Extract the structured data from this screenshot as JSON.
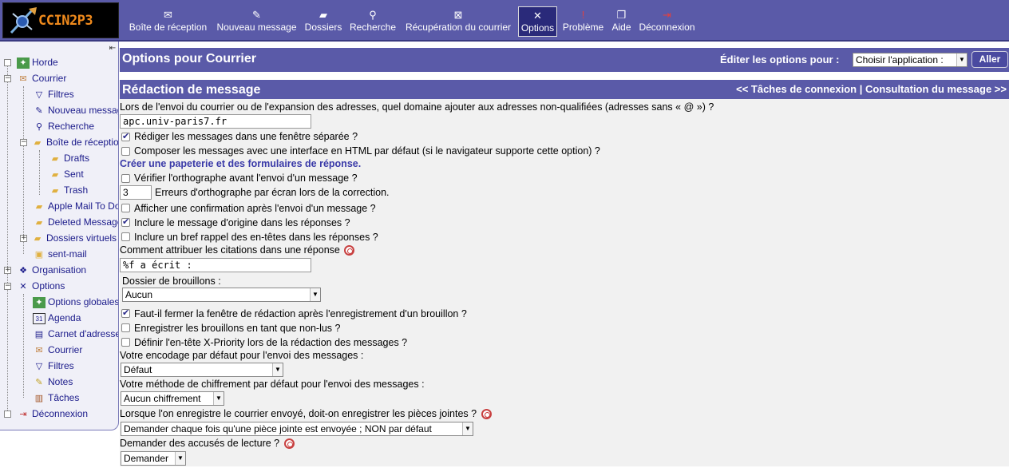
{
  "logo": {
    "text": "CCIN2P3"
  },
  "nav": {
    "items": [
      {
        "label": "Boîte de réception",
        "icon": "mail-icon"
      },
      {
        "label": "Nouveau message",
        "icon": "compose-icon"
      },
      {
        "label": "Dossiers",
        "icon": "folder-icon"
      },
      {
        "label": "Recherche",
        "icon": "search-icon"
      },
      {
        "label": "Récupération du courrier",
        "icon": "fetch-mail-icon"
      },
      {
        "label": "Options",
        "icon": "tools-icon",
        "active": true
      },
      {
        "label": "Problème",
        "icon": "problem-icon"
      },
      {
        "label": "Aide",
        "icon": "help-book-icon"
      },
      {
        "label": "Déconnexion",
        "icon": "logout-icon"
      }
    ]
  },
  "sidebar": {
    "items": [
      {
        "label": "Horde",
        "icon": "horde-icon"
      },
      {
        "label": "Courrier",
        "icon": "mail-icon"
      },
      {
        "label": "Filtres",
        "icon": "filter-icon"
      },
      {
        "label": "Nouveau message",
        "icon": "compose-icon"
      },
      {
        "label": "Recherche",
        "icon": "search-icon"
      },
      {
        "label": "Boîte de réception",
        "icon": "folder-icon"
      },
      {
        "label": "Drafts",
        "icon": "folder-icon"
      },
      {
        "label": "Sent",
        "icon": "folder-icon"
      },
      {
        "label": "Trash",
        "icon": "folder-icon"
      },
      {
        "label": "Apple Mail To Do",
        "icon": "folder-icon"
      },
      {
        "label": "Deleted Messages",
        "icon": "folder-icon"
      },
      {
        "label": "Dossiers virtuels",
        "icon": "folder-icon"
      },
      {
        "label": "sent-mail",
        "icon": "sent-mail-icon"
      },
      {
        "label": "Organisation",
        "icon": "organisation-icon"
      },
      {
        "label": "Options",
        "icon": "tools-icon"
      },
      {
        "label": "Options globales",
        "icon": "horde-icon"
      },
      {
        "label": "Agenda",
        "icon": "calendar-icon"
      },
      {
        "label": "Carnet d'adresses",
        "icon": "addressbook-icon"
      },
      {
        "label": "Courrier",
        "icon": "mail-icon"
      },
      {
        "label": "Filtres",
        "icon": "filter-icon"
      },
      {
        "label": "Notes",
        "icon": "notes-icon"
      },
      {
        "label": "Tâches",
        "icon": "tasks-icon"
      },
      {
        "label": "Déconnexion",
        "icon": "logout-icon"
      }
    ]
  },
  "header": {
    "title": "Options pour Courrier",
    "edit_label": "Éditer les options pour :",
    "app_select_value": "Choisir l'application :",
    "go_label": "Aller"
  },
  "section": {
    "title": "Rédaction de message",
    "prev_link": "<< Tâches de connexion",
    "separator": "|",
    "next_link": "Consultation du message >>"
  },
  "form": {
    "domain_question": "Lors de l'envoi du courrier ou de l'expansion des adresses, quel domaine ajouter aux adresses non-qualifiées (adresses sans « @ ») ?",
    "domain_value": "apc.univ-paris7.fr",
    "separate_window": {
      "label": "Rédiger les messages dans une fenêtre séparée ?",
      "checked": true
    },
    "html_compose": {
      "label": "Composer les messages avec une interface en HTML par défaut (si le navigateur supporte cette option) ?",
      "checked": false
    },
    "stationery_link": "Créer une papeterie et des formulaires de réponse.",
    "spellcheck": {
      "label": "Vérifier l'orthographe avant l'envoi d'un message ?",
      "checked": false
    },
    "spell_errors_value": "3",
    "spell_errors_label": "Erreurs d'orthographe par écran lors de la correction.",
    "confirm_send": {
      "label": "Afficher une confirmation après l'envoi d'un message ?",
      "checked": false
    },
    "include_original": {
      "label": "Inclure le message d'origine dans les réponses ?",
      "checked": true
    },
    "include_headers": {
      "label": "Inclure un bref rappel des en-têtes dans les réponses ?",
      "checked": false
    },
    "attribution_label": "Comment attribuer les citations dans une réponse",
    "attribution_value": "%f a écrit :",
    "drafts_folder_label": "Dossier de brouillons :",
    "drafts_folder_value": "Aucun",
    "close_after_draft": {
      "label": "Faut-il fermer la fenêtre de rédaction après l'enregistrement d'un brouillon ?",
      "checked": true
    },
    "drafts_unseen": {
      "label": "Enregistrer les brouillons en tant que non-lus ?",
      "checked": false
    },
    "x_priority": {
      "label": "Définir l'en-tête X-Priority lors de la rédaction des messages ?",
      "checked": false
    },
    "encoding_label": "Votre encodage par défaut pour l'envoi des messages :",
    "encoding_value": "Défaut",
    "encryption_label": "Votre méthode de chiffrement par défaut pour l'envoi des messages :",
    "encryption_value": "Aucun chiffrement",
    "save_attachments_label": "Lorsque l'on enregistre le courrier envoyé, doit-on enregistrer les pièces jointes ?",
    "save_attachments_value": "Demander chaque fois qu'une pièce jointe est envoyée ; NON par défaut",
    "read_receipt_label": "Demander des accusés de lecture ?",
    "read_receipt_value": "Demander"
  }
}
